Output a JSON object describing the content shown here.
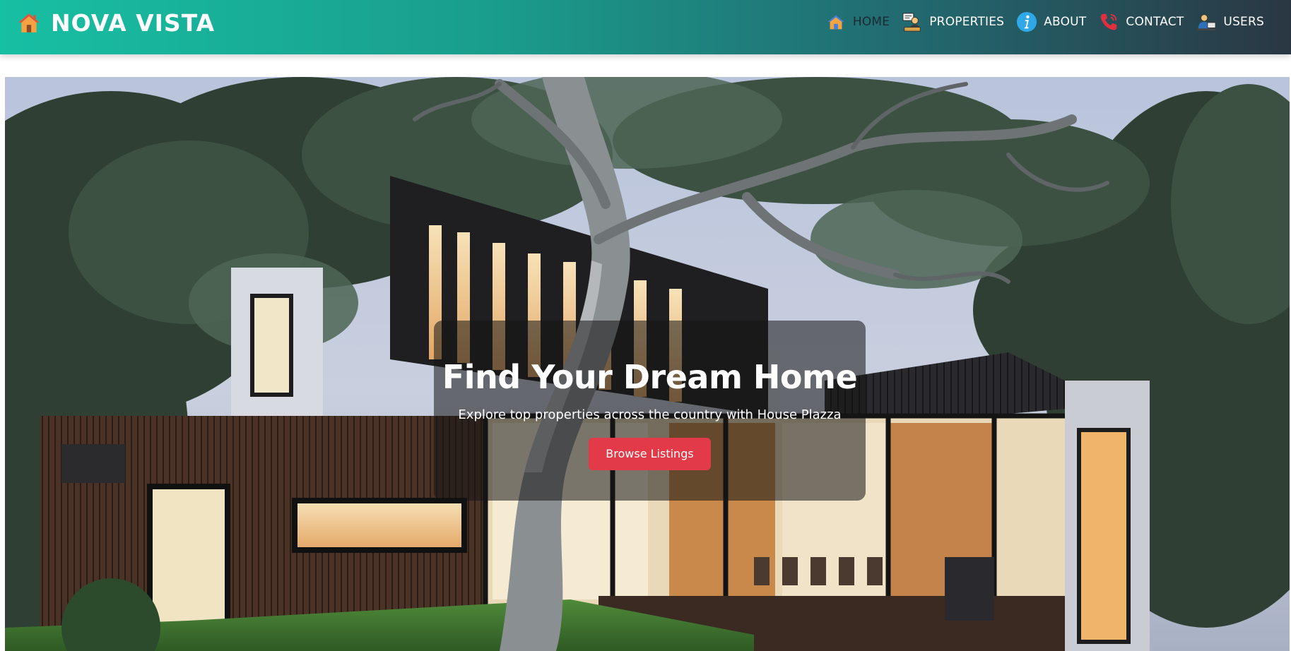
{
  "navbar": {
    "brand": {
      "icon": "house-icon",
      "name": "NOVA VISTA"
    },
    "items": [
      {
        "label": "HOME",
        "icon": "house-icon",
        "active": true
      },
      {
        "label": "PROPERTIES",
        "icon": "agent-desk-icon",
        "active": false
      },
      {
        "label": "ABOUT",
        "icon": "info-icon",
        "active": false
      },
      {
        "label": "CONTACT",
        "icon": "phone-icon",
        "active": false
      },
      {
        "label": "USERS",
        "icon": "users-icon",
        "active": false
      }
    ]
  },
  "hero": {
    "background": "modern-house-under-tree-photo",
    "title": "Find Your Dream Home",
    "subtitle": "Explore top properties across the country with House Plazza",
    "cta_label": "Browse Listings"
  },
  "colors": {
    "navbar_start": "#17bfa3",
    "navbar_end": "#2a3743",
    "cta": "#e23a48",
    "active_nav_text": "#1b2a33"
  }
}
